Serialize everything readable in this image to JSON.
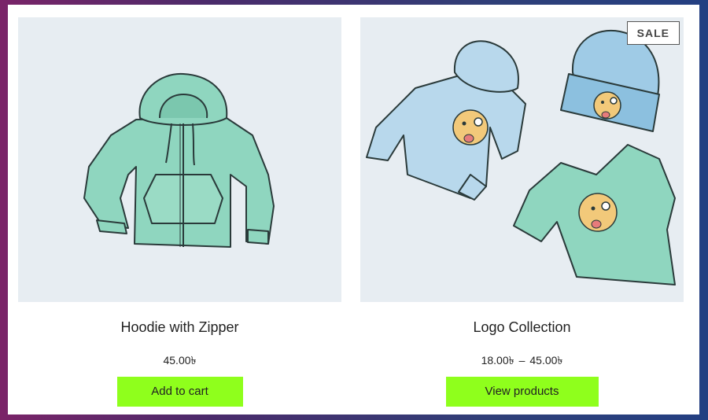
{
  "products": [
    {
      "title": "Hoodie with Zipper",
      "price": "45.00৳",
      "button_label": "Add to cart",
      "image_icon": "zip-hoodie-illustration"
    },
    {
      "title": "Logo Collection",
      "price_min": "18.00৳",
      "price_separator": "–",
      "price_max": "45.00৳",
      "badge": "SALE",
      "button_label": "View products",
      "image_icon": "logo-collection-illustration"
    }
  ],
  "colors": {
    "button_bg": "#8fff1c",
    "thumb_bg": "#e7edf2",
    "mint": "#8fd6bf",
    "light_blue": "#b8d8ec"
  }
}
